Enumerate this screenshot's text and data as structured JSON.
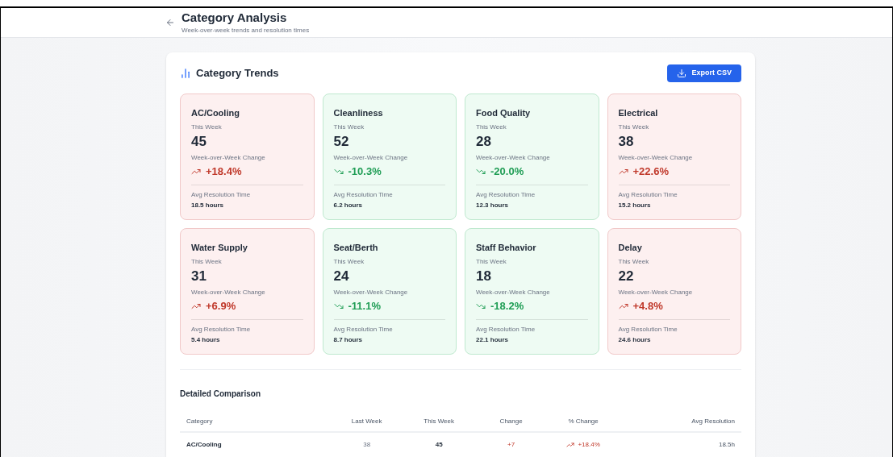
{
  "header": {
    "title": "Category Analysis",
    "subtitle": "Week-over-week trends and resolution times"
  },
  "panel": {
    "title": "Category Trends",
    "export_button": "Export CSV"
  },
  "cards": [
    {
      "name": "AC/Cooling",
      "this_week_label": "This Week",
      "this_week": "45",
      "change_label": "Week-over-Week Change",
      "kind": "up",
      "change": "+18.4%",
      "resolution_label": "Avg Resolution Time",
      "resolution": "18.5 hours"
    },
    {
      "name": "Cleanliness",
      "this_week_label": "This Week",
      "this_week": "52",
      "change_label": "Week-over-Week Change",
      "kind": "down",
      "change": "-10.3%",
      "resolution_label": "Avg Resolution Time",
      "resolution": "6.2 hours"
    },
    {
      "name": "Food Quality",
      "this_week_label": "This Week",
      "this_week": "28",
      "change_label": "Week-over-Week Change",
      "kind": "down",
      "change": "-20.0%",
      "resolution_label": "Avg Resolution Time",
      "resolution": "12.3 hours"
    },
    {
      "name": "Electrical",
      "this_week_label": "This Week",
      "this_week": "38",
      "change_label": "Week-over-Week Change",
      "kind": "up",
      "change": "+22.6%",
      "resolution_label": "Avg Resolution Time",
      "resolution": "15.2 hours"
    },
    {
      "name": "Water Supply",
      "this_week_label": "This Week",
      "this_week": "31",
      "change_label": "Week-over-Week Change",
      "kind": "up",
      "change": "+6.9%",
      "resolution_label": "Avg Resolution Time",
      "resolution": "5.4 hours"
    },
    {
      "name": "Seat/Berth",
      "this_week_label": "This Week",
      "this_week": "24",
      "change_label": "Week-over-Week Change",
      "kind": "down",
      "change": "-11.1%",
      "resolution_label": "Avg Resolution Time",
      "resolution": "8.7 hours"
    },
    {
      "name": "Staff Behavior",
      "this_week_label": "This Week",
      "this_week": "18",
      "change_label": "Week-over-Week Change",
      "kind": "down",
      "change": "-18.2%",
      "resolution_label": "Avg Resolution Time",
      "resolution": "22.1 hours"
    },
    {
      "name": "Delay",
      "this_week_label": "This Week",
      "this_week": "22",
      "change_label": "Week-over-Week Change",
      "kind": "up",
      "change": "+4.8%",
      "resolution_label": "Avg Resolution Time",
      "resolution": "24.6 hours"
    }
  ],
  "comparison": {
    "title": "Detailed Comparison",
    "columns": [
      "Category",
      "Last Week",
      "This Week",
      "Change",
      "% Change",
      "Avg Resolution"
    ],
    "rows": [
      {
        "category": "AC/Cooling",
        "last_week": "38",
        "this_week": "45",
        "kind": "up",
        "change": "+7",
        "pct_change": "+18.4%",
        "avg_resolution": "18.5h"
      }
    ]
  }
}
